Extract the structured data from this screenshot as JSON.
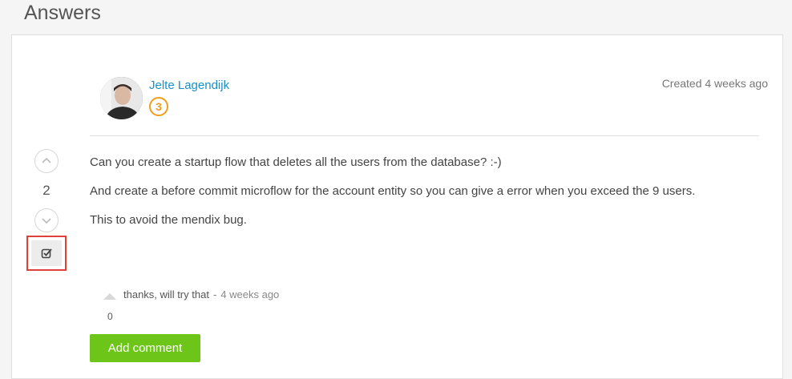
{
  "page": {
    "title": "Answers"
  },
  "answer": {
    "author": {
      "name": "Jelte Lagendijk",
      "reputation": "3",
      "avatar_icon": "user-avatar"
    },
    "created": "Created 4 weeks ago",
    "votes": "2",
    "paragraphs": [
      "Can you create a startup flow that deletes all the users from the database? :-)",
      "And create a before commit microflow for the account entity so you can give a error when you exceed the 9 users.",
      "This to avoid the mendix bug."
    ]
  },
  "comment": {
    "text": "thanks, will try that",
    "separator": "-",
    "time": "4 weeks ago",
    "votes": "0"
  },
  "actions": {
    "add_comment_label": "Add comment"
  },
  "colors": {
    "link": "#1a8fc9",
    "reputation": "#f29b1d",
    "primary_button": "#6dc51a",
    "highlight": "#e0403c"
  }
}
